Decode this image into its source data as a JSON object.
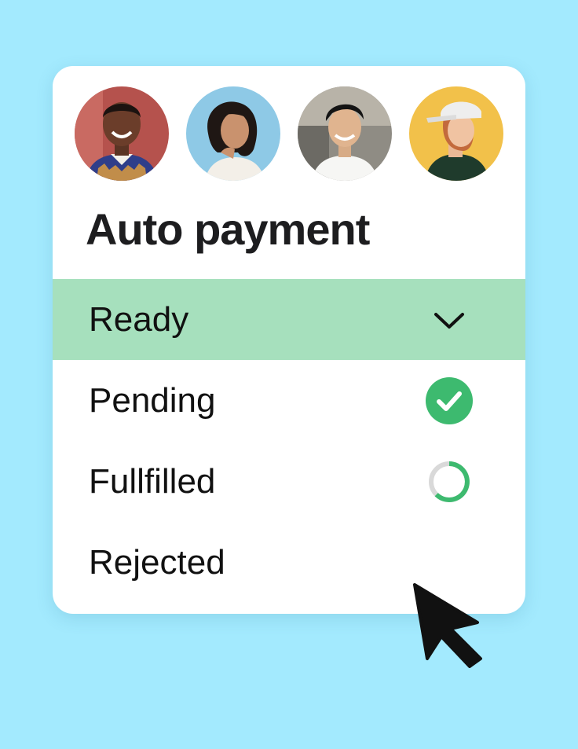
{
  "card": {
    "title": "Auto payment",
    "avatars": [
      {
        "name": "user-avatar-1",
        "background": "#b5524d"
      },
      {
        "name": "user-avatar-2",
        "background": "#8ec9e6"
      },
      {
        "name": "user-avatar-3",
        "background": "#9a9a92"
      },
      {
        "name": "user-avatar-4",
        "background": "#f2c14a"
      }
    ],
    "statuses": [
      {
        "label": "Ready",
        "selected": true,
        "icon": "chevron-down-icon"
      },
      {
        "label": "Pending",
        "selected": false,
        "icon": "check-circle-icon"
      },
      {
        "label": "Fullfilled",
        "selected": false,
        "icon": "progress-ring-icon"
      },
      {
        "label": "Rejected",
        "selected": false,
        "icon": ""
      }
    ]
  },
  "colors": {
    "background": "#a3eafe",
    "selected_row": "#a6e0bd",
    "success_green": "#3dba6f",
    "text": "#111111"
  },
  "cursor": {
    "icon": "mouse-pointer-icon"
  }
}
